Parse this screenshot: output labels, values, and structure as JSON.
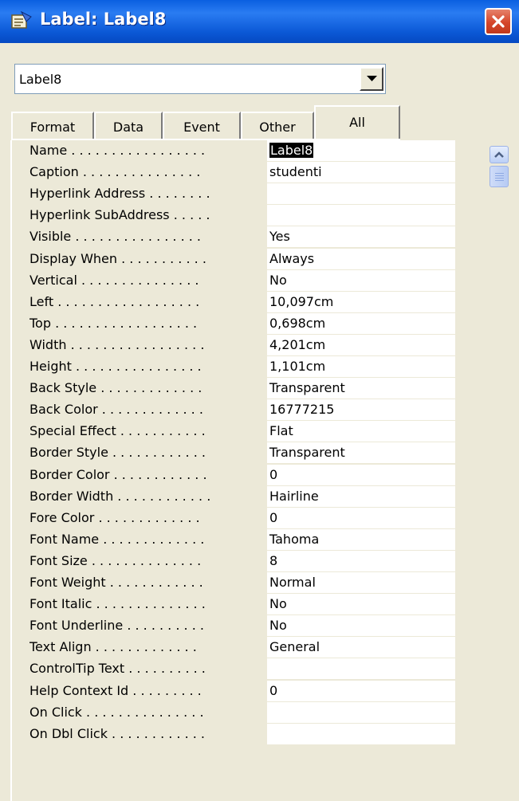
{
  "window": {
    "title": "Label: Label8",
    "icon": "properties-sheet-icon",
    "close_icon": "close-icon"
  },
  "selector": {
    "value": "Label8",
    "button_icon": "chevron-down-icon"
  },
  "tabs": [
    {
      "label": "Format",
      "active": false
    },
    {
      "label": "Data",
      "active": false
    },
    {
      "label": "Event",
      "active": false
    },
    {
      "label": "Other",
      "active": false
    },
    {
      "label": "All",
      "active": true
    }
  ],
  "properties": [
    {
      "label": "Name . . . . . . . . . . . . . . . . .",
      "value": "Label8",
      "selected": true
    },
    {
      "label": "Caption . . . . . . . . . . . . . . .",
      "value": "studenti"
    },
    {
      "label": "Hyperlink Address . . . . . . . .",
      "value": ""
    },
    {
      "label": "Hyperlink SubAddress . . . . .",
      "value": ""
    },
    {
      "label": "Visible . . . . . . . . . . . . . . . .",
      "value": "Yes"
    },
    {
      "label": "Display When . . . . . . . . . . .",
      "value": "Always"
    },
    {
      "label": "Vertical . . . . . . . . . . . . . . .",
      "value": "No"
    },
    {
      "label": "Left . . . . . . . . . . . . . . . . . .",
      "value": "10,097cm"
    },
    {
      "label": "Top . . . . . . . . . . . . . . . . . .",
      "value": "0,698cm"
    },
    {
      "label": "Width . . . . . . . . . . . . . . . . .",
      "value": "4,201cm"
    },
    {
      "label": "Height . . . . . . . . . . . . . . . .",
      "value": "1,101cm"
    },
    {
      "label": "Back Style . . . . . . . . . . . . .",
      "value": "Transparent"
    },
    {
      "label": "Back Color . . . . . . . . . . . . .",
      "value": "16777215"
    },
    {
      "label": "Special Effect . . . . . . . . . . .",
      "value": "Flat"
    },
    {
      "label": "Border Style . . . . . . . . . . . .",
      "value": "Transparent"
    },
    {
      "label": "Border Color . . . . . . . . . . . .",
      "value": "0"
    },
    {
      "label": "Border Width . . . . . . . . . . . .",
      "value": "Hairline"
    },
    {
      "label": "Fore Color . . . . . . . . . . . . .",
      "value": "0"
    },
    {
      "label": "Font Name . . . . . . . . . . . . .",
      "value": "Tahoma"
    },
    {
      "label": "Font Size . . . . . . . . . . . . . .",
      "value": "8"
    },
    {
      "label": "Font Weight . . . . . . . . . . . .",
      "value": "Normal"
    },
    {
      "label": "Font Italic . . . . . . . . . . . . . .",
      "value": "No"
    },
    {
      "label": "Font Underline . . . . . . . . . .",
      "value": "No"
    },
    {
      "label": "Text Align . . . . . . . . . . . . .",
      "value": "General"
    },
    {
      "label": "ControlTip Text . . . . . . . . . .",
      "value": ""
    },
    {
      "label": "Help Context Id . . . . . . . . .",
      "value": "0"
    },
    {
      "label": "On Click . . . . . . . . . . . . . . .",
      "value": ""
    },
    {
      "label": "On Dbl Click . . . . . . . . . . . .",
      "value": ""
    }
  ],
  "scrollbar": {
    "up_icon": "scroll-up-arrow-icon",
    "thumb_icon": "scroll-thumb-icon"
  },
  "colors": {
    "titlebar": "#0a5fe0",
    "dialog": "#ece9d8",
    "close": "#d5452a"
  }
}
